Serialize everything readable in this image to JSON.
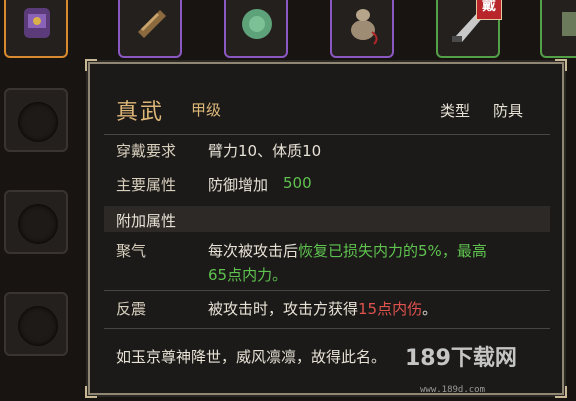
{
  "inventory": {
    "slots_top": [
      {
        "rarity": "orange",
        "icon": "armor-icon"
      },
      {
        "rarity": "purple",
        "icon": "scroll-icon"
      },
      {
        "rarity": "purple",
        "icon": "jade-icon"
      },
      {
        "rarity": "purple",
        "icon": "gourd-icon"
      },
      {
        "rarity": "green",
        "icon": "blade-icon",
        "badge": "戴"
      },
      {
        "rarity": "green",
        "icon": "item-icon"
      }
    ]
  },
  "tooltip": {
    "name": "真武",
    "grade": "甲级",
    "type_label": "类型",
    "type_value": "防具",
    "requirement_label": "穿戴要求",
    "requirement_value": "臂力10、体质10",
    "main_attr_label": "主要属性",
    "main_attr_text": "防御增加",
    "main_attr_value": "500",
    "extra_section": "附加属性",
    "extras": [
      {
        "name": "聚气",
        "line1_a": "每次被攻击后",
        "line1_b": "恢复已损失内力的5%，最高",
        "line2": "65点内力。"
      },
      {
        "name": "反震",
        "line1_a": "被攻击时，攻击方获得",
        "line1_b": "15点内伤",
        "line1_c": "。"
      }
    ],
    "flavor": "如玉京尊神降世，威风凛凛，故得此名。"
  },
  "watermark": {
    "text": "189下载网",
    "url": "www.189d.com"
  }
}
